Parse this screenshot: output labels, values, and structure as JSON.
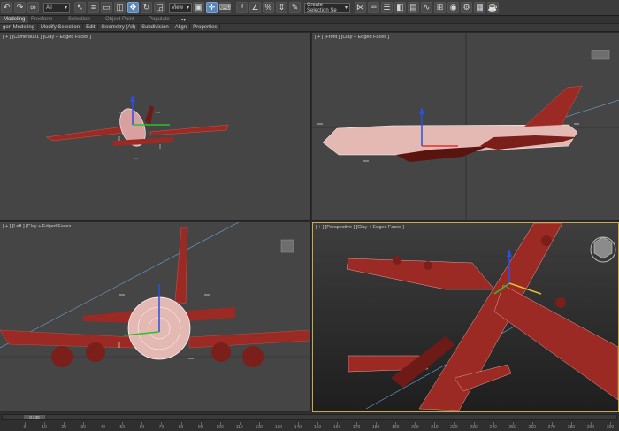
{
  "toolbar": {
    "selection_filter": "All",
    "ref_coord": "View",
    "named_selection": "Create Selection Se",
    "icons": [
      "undo-icon",
      "redo-icon",
      "link-icon",
      "unlink-icon",
      "bind-spacewarp-icon",
      "selection-filter-dropdown",
      "select-object-icon",
      "select-by-name-icon",
      "rectangle-selection-icon",
      "window-crossing-icon",
      "move-icon",
      "rotate-icon",
      "scale-icon",
      "reference-coordinate-dropdown",
      "pivot-icon",
      "keyboard-shortcut-icon",
      "snaps-toggle-icon",
      "angle-snap-icon",
      "percent-snap-icon",
      "spinner-snap-icon",
      "edit-named-selection-icon",
      "named-selection-dropdown",
      "mirror-icon",
      "align-icon",
      "toggle-scene-explorer-icon",
      "toggle-layer-explorer-icon",
      "toggle-ribbon-icon",
      "curve-editor-icon",
      "schematic-view-icon",
      "material-editor-icon",
      "render-setup-icon",
      "rendered-frame-icon",
      "render-icon"
    ]
  },
  "ribbon": {
    "tabs": [
      "Modeling",
      "Freeform",
      "Selection",
      "Object Paint",
      "Populate"
    ],
    "sub_items": [
      "gon Modeling",
      "Modify Selection",
      "Edit",
      "Geometry (All)",
      "Subdivision",
      "Align",
      "Properties"
    ]
  },
  "viewports": {
    "top_left": "[ + ] [Camera001 ] [Clay + Edged Faces ]",
    "top_right": "[ + ] [Front ] [Clay + Edged Faces ]",
    "bottom_left": "[ + ] [Left ] [Clay + Edged Faces ]",
    "bottom_right": "[ + ] [Perspective ] [Clay + Edged Faces ]"
  },
  "timeline": {
    "frame_display": "0 / 30",
    "ticks": [
      "0",
      "10",
      "20",
      "30",
      "40",
      "50",
      "60",
      "70",
      "80",
      "90",
      "100",
      "110",
      "120",
      "130",
      "140",
      "150",
      "160",
      "170",
      "180",
      "190",
      "200",
      "210",
      "220",
      "230",
      "240",
      "250",
      "260",
      "270",
      "280",
      "290",
      "300"
    ]
  },
  "colors": {
    "accent": "#5a86b5",
    "airplane": "#9c2a24",
    "active_viewport_border": "#c9a94a"
  }
}
